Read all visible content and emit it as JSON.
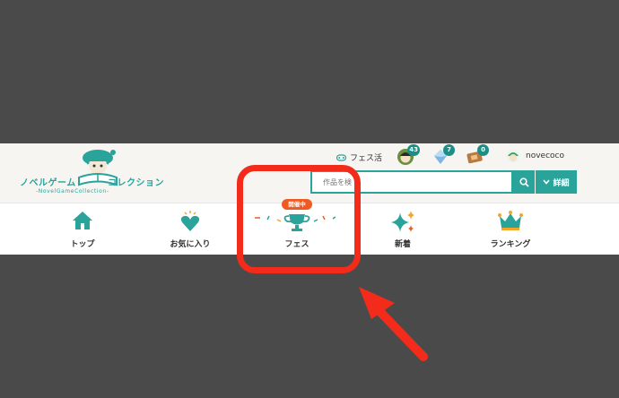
{
  "logo": {
    "left_text": "ノベルゲーム",
    "right_text": "コレクション",
    "sub_text": "-NovelGameCollection-"
  },
  "userbar": {
    "fes_activity": "フェス活",
    "badges": [
      {
        "icon": "avatar-badge-icon",
        "count": "43"
      },
      {
        "icon": "gem-badge-icon",
        "count": "7"
      },
      {
        "icon": "ticket-badge-icon",
        "count": "0"
      }
    ],
    "username": "novecoco"
  },
  "search": {
    "placeholder": "作品を検",
    "detail_label": "詳細"
  },
  "nav": {
    "items": [
      {
        "label": "トップ",
        "icon": "home-icon"
      },
      {
        "label": "お気に入り",
        "icon": "heart-icon"
      },
      {
        "label": "フェス",
        "icon": "trophy-icon",
        "badge": "開催中"
      },
      {
        "label": "新着",
        "icon": "sparkle-icon"
      },
      {
        "label": "ランキング",
        "icon": "crown-icon"
      }
    ]
  },
  "colors": {
    "accent": "#2aa39a",
    "badge": "#ee5a22",
    "annotation": "#f22b1a",
    "backdrop": "#4a4a4a"
  }
}
